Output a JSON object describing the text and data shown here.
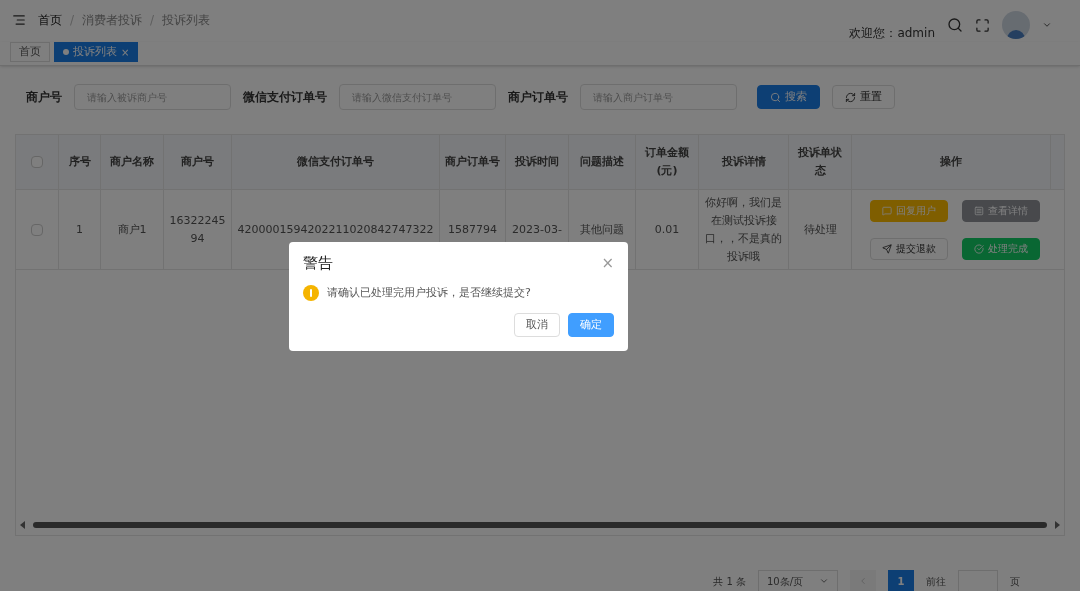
{
  "breadcrumb": [
    {
      "label": "首页"
    },
    {
      "label": "消费者投诉",
      "separator": "/"
    },
    {
      "label": "投诉列表",
      "separator": "/"
    }
  ],
  "header": {
    "welcome": "欢迎您：admin"
  },
  "tabs": [
    {
      "label": "首页",
      "selected": false,
      "closable": false
    },
    {
      "label": "投诉列表",
      "selected": true,
      "closable": true
    }
  ],
  "tab_close": "×",
  "search": {
    "fields": [
      {
        "label": "商户号",
        "placeholder": "请输入被诉商户号"
      },
      {
        "label": "微信支付订单号",
        "placeholder": "请输入微信支付订单号"
      },
      {
        "label": "商户订单号",
        "placeholder": "请输入商户订单号"
      }
    ],
    "buttons": [
      {
        "label": "搜索",
        "kind": "primary"
      },
      {
        "label": "重置",
        "kind": "plain"
      }
    ]
  },
  "table": {
    "all_checked": false,
    "columns": [
      "序号",
      "商户名称",
      "商户号",
      "微信支付订单号",
      "商户订单号",
      "投诉时间",
      "问题描述",
      "订单金额(元)",
      "投诉详情",
      "投诉单状态",
      "操作"
    ],
    "rows": [
      {
        "checked": false,
        "cells": [
          "1",
          "商户1",
          "1632224594",
          "4200001594202211020842747322",
          "1587794",
          "2023-03-",
          "其他问题",
          "0.01",
          "你好啊，我们是在测试投诉接口，，不是真的投诉哦",
          "待处理"
        ],
        "actions": [
          {
            "label": "回复用户",
            "kind": "warning"
          },
          {
            "label": "查看详情",
            "kind": "info"
          },
          {
            "label": "提交退款",
            "kind": "plain"
          },
          {
            "label": "处理完成",
            "kind": "success"
          }
        ]
      }
    ]
  },
  "pagination": {
    "total": "共 1 条",
    "page_size": "10条/页",
    "pages": [
      {
        "label": "1",
        "selected": true
      }
    ],
    "goto_prefix": "前往",
    "goto_suffix": "页"
  },
  "dialog": {
    "title": "警告",
    "message": "请确认已处理完用户投诉，是否继续提交?",
    "close": "×",
    "buttons": [
      {
        "label": "取消",
        "kind": "plain"
      },
      {
        "label": "确定",
        "kind": "primary"
      }
    ]
  }
}
